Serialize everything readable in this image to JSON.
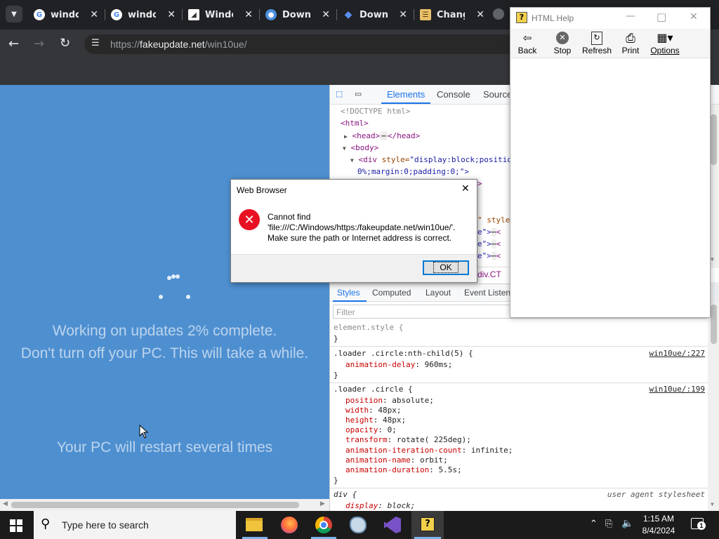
{
  "browser": {
    "tabs": [
      {
        "title": "window",
        "icon": "google-icon"
      },
      {
        "title": "window",
        "icon": "google-icon"
      },
      {
        "title": "Windo",
        "icon": "windows-logo-icon"
      },
      {
        "title": "Downl",
        "icon": "download-globe-icon"
      },
      {
        "title": "Downl",
        "icon": "download-diamond-icon"
      },
      {
        "title": "Chang",
        "icon": "changelog-icon"
      }
    ],
    "url_prefix": "https://",
    "url_host": "fakeupdate.net",
    "url_path": "/win10ue/"
  },
  "page": {
    "line1": "Working on updates  2% complete.",
    "line2": "Don't turn off your PC. This will take a while.",
    "line3": "Your PC will restart several times"
  },
  "devtools": {
    "tabs": [
      "Elements",
      "Console",
      "Sources"
    ],
    "elements": {
      "doctype": "<!DOCTYPE html>",
      "html_open": "<html>",
      "head_open": "<head>",
      "head_ellipsis": "⋯",
      "head_close": "</head>",
      "body_open": "<body>",
      "div_tag": "<div",
      "div_style_attr": "style=",
      "div_style_val": "\"display:block;positio",
      "div_style_val2": "0%;margin:0;padding:0;\">",
      "row_gt": ">",
      "row_style_frag": "\" style=",
      "row_a": "e\">",
      "row_b": "e\">",
      "row_c": "e\">",
      "row_ellipsis": "⋯",
      "row_lt": "<",
      "breadcrumb": "div.CT"
    },
    "styles_tabs": [
      "Styles",
      "Computed",
      "Layout",
      "Event Listene"
    ],
    "filter_placeholder": "Filter",
    "rules": {
      "element_style": "element.style {",
      "close": "}",
      "r1_selector": ".loader .circle:nth-child(5) {",
      "r1_link": "win10ue/:227",
      "r1_prop": "animation-delay",
      "r1_val": "960ms;",
      "r2_selector": ".loader .circle {",
      "r2_link": "win10ue/:199",
      "r2_props": [
        {
          "name": "position",
          "value": "absolute;"
        },
        {
          "name": "width",
          "value": "48px;"
        },
        {
          "name": "height",
          "value": "48px;"
        },
        {
          "name": "opacity",
          "value": "0;"
        },
        {
          "name": "transform",
          "value": "rotate(   225deg);"
        },
        {
          "name": "animation-iteration-count",
          "value": "infinite;"
        },
        {
          "name": "animation-name",
          "value": "orbit;"
        },
        {
          "name": "animation-duration",
          "value": "5.5s;"
        }
      ],
      "r3_selector": "div {",
      "r3_origin": "user agent stylesheet",
      "r3_prop": "display",
      "r3_val": "block;"
    }
  },
  "dialog": {
    "title": "Web Browser",
    "line1": "Cannot find",
    "line2": "'file:///C:/Windows/https:/fakeupdate.net/win10ue/'.",
    "line3": "Make sure the path or Internet address is correct.",
    "ok": "OK"
  },
  "help": {
    "title": "HTML Help",
    "buttons": [
      "Back",
      "Stop",
      "Refresh",
      "Print",
      "Options"
    ]
  },
  "taskbar": {
    "search_placeholder": "Type here to search",
    "time": "1:15 AM",
    "date": "8/4/2024",
    "notification_count": "1"
  },
  "colors": {
    "page_blue": "#4e8fd0",
    "devtools_accent": "#1a73e8",
    "error_red": "#e81123"
  }
}
